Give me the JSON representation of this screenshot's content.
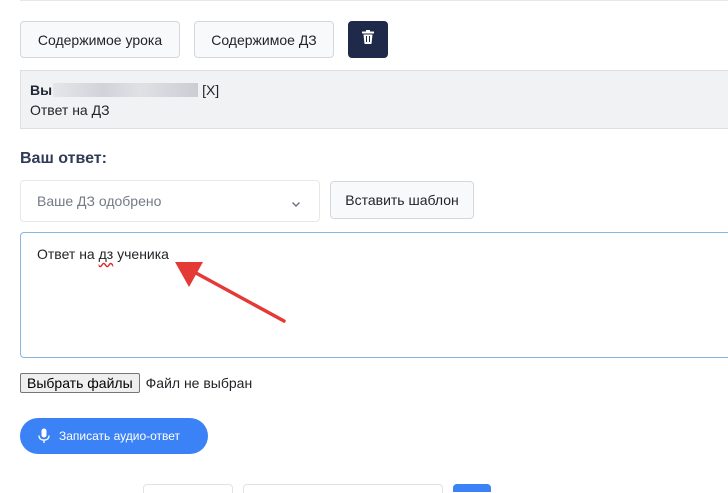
{
  "toolbar": {
    "lesson_content_label": "Содержимое урока",
    "hw_content_label": "Содержимое ДЗ",
    "delete_icon": "trash-icon"
  },
  "homework": {
    "student_prefix": "Вы",
    "close_mark": "[X]",
    "answer_text": "Ответ на ДЗ"
  },
  "reply": {
    "section_title": "Ваш ответ:",
    "status_select": {
      "selected": "Ваше ДЗ одобрено"
    },
    "insert_template_label": "Вставить шаблон",
    "answer_before": "Ответ на ",
    "answer_misspelled": "дз",
    "answer_after": " ученика"
  },
  "file_upload": {
    "button_label": "Выбрать файлы",
    "status": "Файл не выбран"
  },
  "audio": {
    "button_label": "Записать аудио-ответ",
    "icon": "microphone-icon"
  },
  "colors": {
    "dark_button": "#1f2a4a",
    "primary": "#3b82f6",
    "arrow": "#e53935",
    "focus_border": "#86b7e2"
  }
}
